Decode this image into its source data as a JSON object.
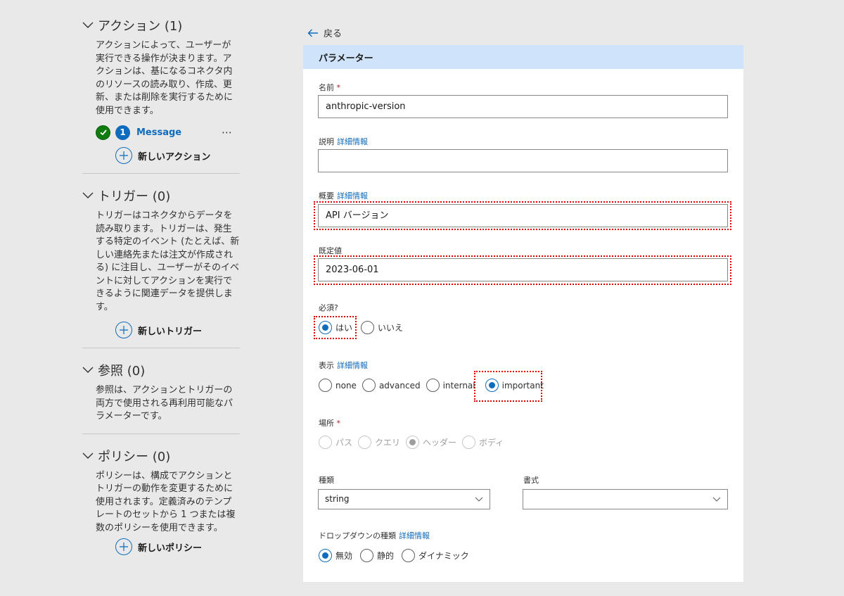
{
  "sidebar": {
    "actions": {
      "title": "アクション (1)",
      "description": "アクションによって、ユーザーが実行できる操作が決まります。アクションは、基になるコネクタ内のリソースの読み取り、作成、更新、または削除を実行するために使用できます。",
      "item": {
        "number": "1",
        "name": "Message",
        "more": "⋯"
      },
      "add_label": "新しいアクション"
    },
    "triggers": {
      "title": "トリガー (0)",
      "description": "トリガーはコネクタからデータを読み取ります。トリガーは、発生する特定のイベント (たとえば、新しい連絡先または注文が作成される) に注目し、ユーザーがそのイベントに対してアクションを実行できるように関連データを提供します。",
      "add_label": "新しいトリガー"
    },
    "references": {
      "title": "参照 (0)",
      "description": "参照は、アクションとトリガーの両方で使用される再利用可能なパラメーターです。"
    },
    "policies": {
      "title": "ポリシー (0)",
      "description": "ポリシーは、構成でアクションとトリガーの動作を変更するために使用されます。定義済みのテンプレートのセットから 1 つまたは複数のポリシーを使用できます。",
      "add_label": "新しいポリシー"
    }
  },
  "back_label": "戻る",
  "panel": {
    "title": "パラメーター",
    "name": {
      "label": "名前",
      "required_mark": "*",
      "value": "anthropic-version"
    },
    "description": {
      "label": "説明",
      "link": "詳細情報",
      "value": ""
    },
    "summary": {
      "label": "概要",
      "link": "詳細情報",
      "value": "API バージョン"
    },
    "default": {
      "label": "既定値",
      "value": "2023-06-01"
    },
    "required": {
      "label": "必須?",
      "options": [
        "はい",
        "いいえ"
      ],
      "selected": "はい"
    },
    "visibility": {
      "label": "表示",
      "link": "詳細情報",
      "options": [
        "none",
        "advanced",
        "internal",
        "important"
      ],
      "selected": "important"
    },
    "location": {
      "label": "場所",
      "required_mark": "*",
      "options": [
        "パス",
        "クエリ",
        "ヘッダー",
        "ボディ"
      ],
      "selected": "ヘッダー",
      "disabled": true
    },
    "type": {
      "label": "種類",
      "value": "string"
    },
    "format": {
      "label": "書式",
      "value": ""
    },
    "dropdown_type": {
      "label": "ドロップダウンの種類",
      "link": "詳細情報",
      "options": [
        "無効",
        "静的",
        "ダイナミック"
      ],
      "selected": "無効"
    }
  },
  "colors": {
    "accent": "#0f6cbd",
    "header_bg": "#cfe4fa",
    "success": "#107c10",
    "highlight": "#e00000"
  }
}
